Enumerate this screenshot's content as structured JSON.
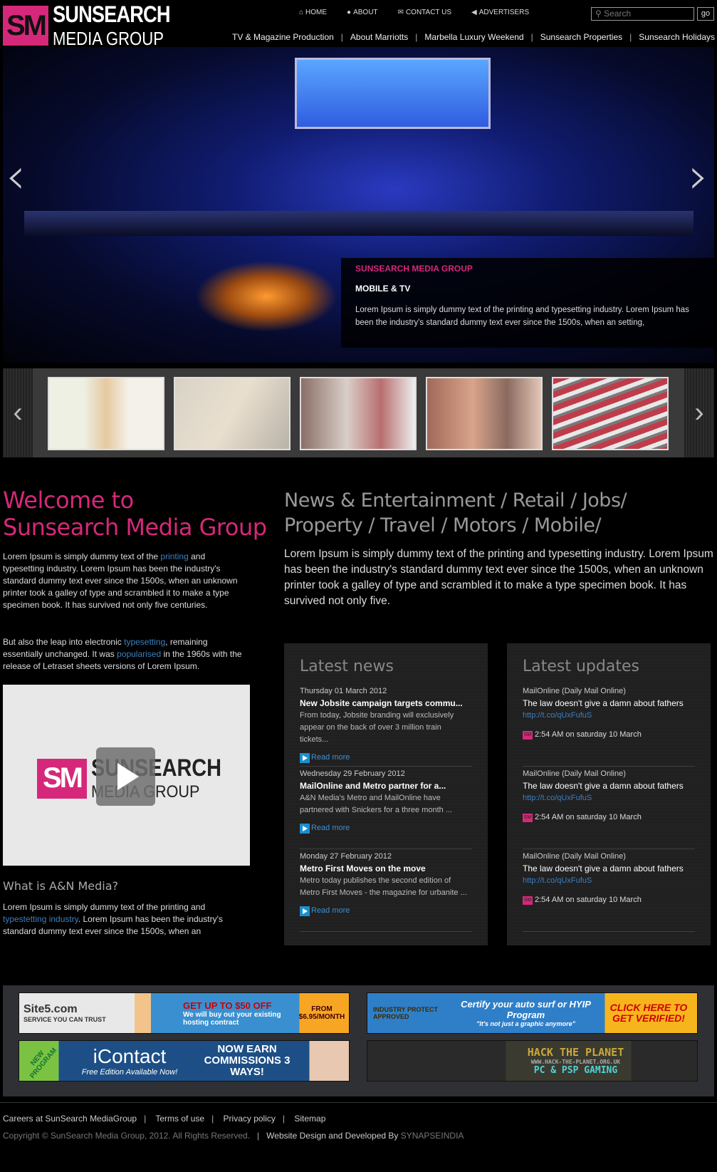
{
  "logo": {
    "mark": "SM",
    "line1": "SUNSEARCH",
    "line2": "MEDIA GROUP"
  },
  "topnav": [
    {
      "label": "HOME",
      "icon": "home-icon"
    },
    {
      "label": "ABOUT",
      "icon": "speech-bubble-icon"
    },
    {
      "label": "CONTACT US",
      "icon": "envelope-icon"
    },
    {
      "label": "ADVERTISERS",
      "icon": "megaphone-icon"
    }
  ],
  "search": {
    "placeholder": "Search",
    "button": "go"
  },
  "subnav": [
    "TV & Magazine Production",
    "About Marriotts",
    "Marbella Luxury Weekend",
    "Sunsearch Properties",
    "Sunsearch Holidays"
  ],
  "hero": {
    "prev": "‹",
    "next": "›",
    "caption_title": "SUNSEARCH MEDIA GROUP",
    "caption_subtitle": "MOBILE & TV",
    "caption_text": "Lorem Ipsum is simply dummy text of the printing and typesetting industry. Lorem Ipsum has been the industry's standard dummy text ever since the 1500s, when an setting,"
  },
  "thumbs": {
    "prev": "‹",
    "next": "›",
    "count": 5
  },
  "welcome": {
    "title_line1": "Welcome to",
    "title_line2": "Sunsearch Media Group",
    "p1_a": "Lorem Ipsum is simply dummy text of the ",
    "p1_link": "printing",
    "p1_b": " and typesetting industry. Lorem Ipsum has been the industry's standard dummy text ever since the 1500s, when an unknown printer took a galley of type and scrambled it to make a type specimen book. It has survived not only five centuries.",
    "p2_a": "But also the leap into electronic ",
    "p2_link1": "typesetting",
    "p2_b": ", remaining essentially unchanged. It was ",
    "p2_link2": "popularised",
    "p2_c": " in the 1960s with the release of Letraset sheets versions of Lorem Ipsum."
  },
  "video": {
    "mark": "SM",
    "line1": "SUNSEARCH",
    "line2": "MEDIA GROUP"
  },
  "what": {
    "title": "What is A&N Media?",
    "p_a": "Lorem Ipsum is simply dummy text of the printing and ",
    "p_link": "typestetting industry",
    "p_b": ". Lorem Ipsum has been the industry's standard dummy text ever since the 1500s, when an"
  },
  "categories": {
    "line1": "News & Entertainment / Retail / Jobs/",
    "line2": "Property / Travel / Motors / Mobile/",
    "text": "Lorem Ipsum is simply dummy text of the printing and typesetting industry. Lorem Ipsum has been the industry's standard dummy text ever since the 1500s, when an unknown printer took a galley of type and scrambled it to make a type specimen book. It has survived not only five."
  },
  "news": {
    "title": "Latest news",
    "read_more": "Read more",
    "items": [
      {
        "date": "Thursday 01 March 2012",
        "title": "New Jobsite campaign targets commu...",
        "summary": "From today, Jobsite branding will exclusively appear on the back of over 3 million train tickets..."
      },
      {
        "date": "Wednesday 29 February 2012",
        "title": "MailOnline and Metro partner for a...",
        "summary": "A&N Media's Metro and MailOnline have partnered with Snickers for a three month ..."
      },
      {
        "date": "Monday 27 February 2012",
        "title": "Metro First Moves on the move",
        "summary": "Metro today publishes the second edition of Metro First Moves - the magazine for urbanite ..."
      }
    ]
  },
  "updates": {
    "title": "Latest updates",
    "badge": "SM",
    "items": [
      {
        "source": "MailOnline (Daily Mail Online)",
        "text": "The law doesn't give a damn about fathers",
        "link": "http://t.co/qUxFufuS",
        "time": "2:54 AM on saturday 10 March"
      },
      {
        "source": "MailOnline (Daily Mail Online)",
        "text": "The law doesn't give a damn about fathers",
        "link": "http://t.co/qUxFufuS",
        "time": "2:54 AM on saturday 10 March"
      },
      {
        "source": "MailOnline (Daily Mail Online)",
        "text": "The law doesn't give a damn about fathers",
        "link": "http://t.co/qUxFufuS",
        "time": "2:54 AM on saturday 10 March"
      }
    ]
  },
  "ads": [
    {
      "brand": "Site5.com",
      "tag": "SERVICE YOU CAN TRUST",
      "headline": "GET UP TO $50 OFF",
      "sub": "We will buy out your existing hosting contract",
      "price": "FROM $6.95/MONTH"
    },
    {
      "badge": "INDUSTRY PROTECT APPROVED",
      "headline": "Certify your auto surf or HYIP Program",
      "sub": "\"It's not just a graphic anymore\"",
      "cta": "CLICK HERE TO GET VERIFIED!"
    },
    {
      "ribbon": "NEW PROGRAM",
      "brand": "iContact",
      "sub": "Free Edition Available Now!",
      "headline": "NOW EARN COMMISSIONS 3 WAYS!"
    },
    {
      "headline": "HACK THE PLANET",
      "url": "WWW.HACK-THE-PLANET.ORG.UK",
      "sub": "PC & PSP GAMING"
    }
  ],
  "footer": {
    "links": [
      "Careers at SunSearch MediaGroup",
      "Terms of use",
      "Privacy policy",
      "Sitemap"
    ],
    "copyright": "Copyright © SunSearch Media Group, 2012. All Rights Reserved.",
    "credit": "Website Design and Developed By ",
    "credit_link": "SYNAPSEINDIA"
  },
  "colors": {
    "accent": "#d6287a",
    "link": "#3d7fc0",
    "background": "#000000"
  }
}
